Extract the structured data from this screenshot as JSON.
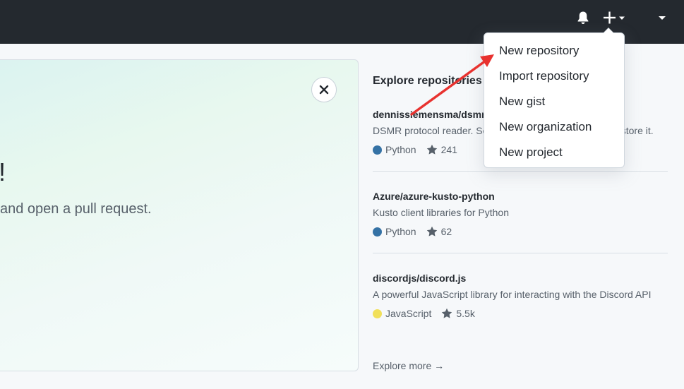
{
  "topbar": {
    "icons": [
      "bell-icon",
      "plus-icon",
      "caret-down-icon"
    ]
  },
  "hero": {
    "headline": "e!",
    "subline": "and open a pull request."
  },
  "explore": {
    "title": "Explore repositories",
    "repos": [
      {
        "name": "dennissiemensma/dsmr-reader",
        "description": "DSMR protocol reader. Send your data to any service or store it.",
        "language": "Python",
        "language_color": "#3572A5",
        "stars": "241"
      },
      {
        "name": "Azure/azure-kusto-python",
        "description": "Kusto client libraries for Python",
        "language": "Python",
        "language_color": "#3572A5",
        "stars": "62"
      },
      {
        "name": "discordjs/discord.js",
        "description": "A powerful JavaScript library for interacting with the Discord API",
        "language": "JavaScript",
        "language_color": "#f1e05a",
        "stars": "5.5k"
      }
    ],
    "more_link": "Explore more →"
  },
  "dropdown": {
    "items": [
      "New repository",
      "Import repository",
      "New gist",
      "New organization",
      "New project"
    ]
  },
  "annotation": {
    "arrow_color": "#e8322f"
  }
}
